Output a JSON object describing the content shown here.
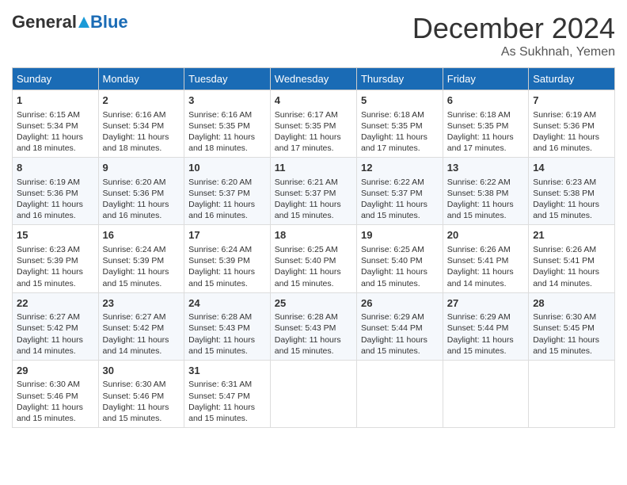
{
  "header": {
    "logo_general": "General",
    "logo_blue": "Blue",
    "month": "December 2024",
    "location": "As Sukhnah, Yemen"
  },
  "weekdays": [
    "Sunday",
    "Monday",
    "Tuesday",
    "Wednesday",
    "Thursday",
    "Friday",
    "Saturday"
  ],
  "weeks": [
    [
      {
        "day": 1,
        "sunrise": "6:15 AM",
        "sunset": "5:34 PM",
        "daylight": "11 hours and 18 minutes."
      },
      {
        "day": 2,
        "sunrise": "6:16 AM",
        "sunset": "5:34 PM",
        "daylight": "11 hours and 18 minutes."
      },
      {
        "day": 3,
        "sunrise": "6:16 AM",
        "sunset": "5:35 PM",
        "daylight": "11 hours and 18 minutes."
      },
      {
        "day": 4,
        "sunrise": "6:17 AM",
        "sunset": "5:35 PM",
        "daylight": "11 hours and 17 minutes."
      },
      {
        "day": 5,
        "sunrise": "6:18 AM",
        "sunset": "5:35 PM",
        "daylight": "11 hours and 17 minutes."
      },
      {
        "day": 6,
        "sunrise": "6:18 AM",
        "sunset": "5:35 PM",
        "daylight": "11 hours and 17 minutes."
      },
      {
        "day": 7,
        "sunrise": "6:19 AM",
        "sunset": "5:36 PM",
        "daylight": "11 hours and 16 minutes."
      }
    ],
    [
      {
        "day": 8,
        "sunrise": "6:19 AM",
        "sunset": "5:36 PM",
        "daylight": "11 hours and 16 minutes."
      },
      {
        "day": 9,
        "sunrise": "6:20 AM",
        "sunset": "5:36 PM",
        "daylight": "11 hours and 16 minutes."
      },
      {
        "day": 10,
        "sunrise": "6:20 AM",
        "sunset": "5:37 PM",
        "daylight": "11 hours and 16 minutes."
      },
      {
        "day": 11,
        "sunrise": "6:21 AM",
        "sunset": "5:37 PM",
        "daylight": "11 hours and 15 minutes."
      },
      {
        "day": 12,
        "sunrise": "6:22 AM",
        "sunset": "5:37 PM",
        "daylight": "11 hours and 15 minutes."
      },
      {
        "day": 13,
        "sunrise": "6:22 AM",
        "sunset": "5:38 PM",
        "daylight": "11 hours and 15 minutes."
      },
      {
        "day": 14,
        "sunrise": "6:23 AM",
        "sunset": "5:38 PM",
        "daylight": "11 hours and 15 minutes."
      }
    ],
    [
      {
        "day": 15,
        "sunrise": "6:23 AM",
        "sunset": "5:39 PM",
        "daylight": "11 hours and 15 minutes."
      },
      {
        "day": 16,
        "sunrise": "6:24 AM",
        "sunset": "5:39 PM",
        "daylight": "11 hours and 15 minutes."
      },
      {
        "day": 17,
        "sunrise": "6:24 AM",
        "sunset": "5:39 PM",
        "daylight": "11 hours and 15 minutes."
      },
      {
        "day": 18,
        "sunrise": "6:25 AM",
        "sunset": "5:40 PM",
        "daylight": "11 hours and 15 minutes."
      },
      {
        "day": 19,
        "sunrise": "6:25 AM",
        "sunset": "5:40 PM",
        "daylight": "11 hours and 15 minutes."
      },
      {
        "day": 20,
        "sunrise": "6:26 AM",
        "sunset": "5:41 PM",
        "daylight": "11 hours and 14 minutes."
      },
      {
        "day": 21,
        "sunrise": "6:26 AM",
        "sunset": "5:41 PM",
        "daylight": "11 hours and 14 minutes."
      }
    ],
    [
      {
        "day": 22,
        "sunrise": "6:27 AM",
        "sunset": "5:42 PM",
        "daylight": "11 hours and 14 minutes."
      },
      {
        "day": 23,
        "sunrise": "6:27 AM",
        "sunset": "5:42 PM",
        "daylight": "11 hours and 14 minutes."
      },
      {
        "day": 24,
        "sunrise": "6:28 AM",
        "sunset": "5:43 PM",
        "daylight": "11 hours and 15 minutes."
      },
      {
        "day": 25,
        "sunrise": "6:28 AM",
        "sunset": "5:43 PM",
        "daylight": "11 hours and 15 minutes."
      },
      {
        "day": 26,
        "sunrise": "6:29 AM",
        "sunset": "5:44 PM",
        "daylight": "11 hours and 15 minutes."
      },
      {
        "day": 27,
        "sunrise": "6:29 AM",
        "sunset": "5:44 PM",
        "daylight": "11 hours and 15 minutes."
      },
      {
        "day": 28,
        "sunrise": "6:30 AM",
        "sunset": "5:45 PM",
        "daylight": "11 hours and 15 minutes."
      }
    ],
    [
      {
        "day": 29,
        "sunrise": "6:30 AM",
        "sunset": "5:46 PM",
        "daylight": "11 hours and 15 minutes."
      },
      {
        "day": 30,
        "sunrise": "6:30 AM",
        "sunset": "5:46 PM",
        "daylight": "11 hours and 15 minutes."
      },
      {
        "day": 31,
        "sunrise": "6:31 AM",
        "sunset": "5:47 PM",
        "daylight": "11 hours and 15 minutes."
      },
      null,
      null,
      null,
      null
    ]
  ]
}
